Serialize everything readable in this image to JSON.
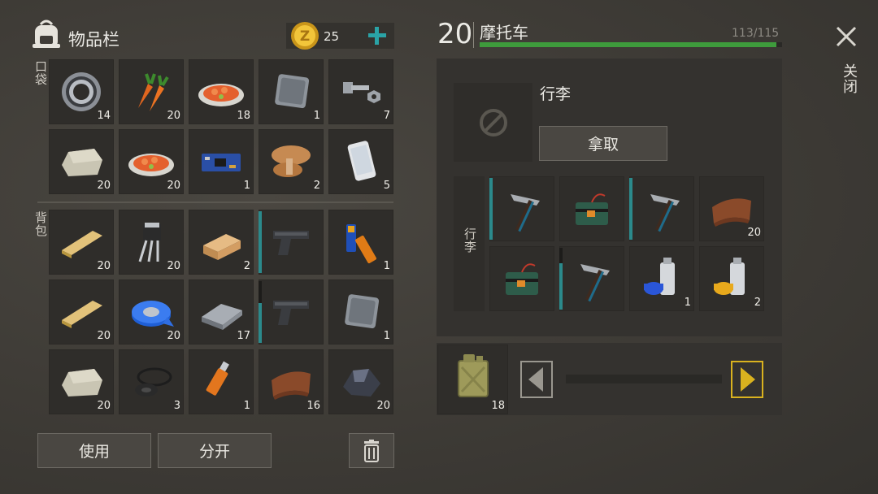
{
  "inventory": {
    "title": "物品栏",
    "coins": "25",
    "pocket_label": "口袋",
    "backpack_label": "背包",
    "pockets": [
      {
        "icon": "bearing-icon",
        "count": "14"
      },
      {
        "icon": "carrot-icon",
        "count": "20"
      },
      {
        "icon": "food-plate-icon",
        "count": "18"
      },
      {
        "icon": "metal-plate-icon",
        "count": "1"
      },
      {
        "icon": "bolt-nut-icon",
        "count": "7"
      },
      {
        "icon": "stone-icon",
        "count": "20"
      },
      {
        "icon": "food-plate-icon",
        "count": "20"
      },
      {
        "icon": "circuit-board-icon",
        "count": "1"
      },
      {
        "icon": "mushroom-icon",
        "count": "2"
      },
      {
        "icon": "smartphone-icon",
        "count": "5"
      }
    ],
    "backpack": [
      {
        "icon": "wood-plank-icon",
        "count": "20"
      },
      {
        "icon": "transistor-icon",
        "count": "20"
      },
      {
        "icon": "wood-block-icon",
        "count": "2"
      },
      {
        "icon": "pistol-icon",
        "count": "",
        "durability": 1.0
      },
      {
        "icon": "batteries-icon",
        "count": "1"
      },
      {
        "icon": "wood-plank-icon",
        "count": "20"
      },
      {
        "icon": "tape-icon",
        "count": "20"
      },
      {
        "icon": "iron-ingot-icon",
        "count": "17"
      },
      {
        "icon": "pistol-icon",
        "count": "",
        "durability": 0.65
      },
      {
        "icon": "metal-plate-icon",
        "count": "1"
      },
      {
        "icon": "stone-icon",
        "count": "20"
      },
      {
        "icon": "rubber-seals-icon",
        "count": "3"
      },
      {
        "icon": "usb-drive-icon",
        "count": "1"
      },
      {
        "icon": "leather-icon",
        "count": "16"
      },
      {
        "icon": "coal-icon",
        "count": "20"
      }
    ],
    "use_button": "使用",
    "split_button": "分开"
  },
  "vehicle": {
    "level": "20",
    "name": "摩托车",
    "capacity": "113/115",
    "capacity_fraction": 0.98,
    "luggage_title": "行李",
    "take_button": "拿取",
    "luggage_side_label": "行李",
    "items": [
      {
        "icon": "pickaxe-icon",
        "count": "",
        "durability": 1.0
      },
      {
        "icon": "explosive-charge-icon",
        "count": ""
      },
      {
        "icon": "pickaxe-icon",
        "count": "",
        "durability": 1.0
      },
      {
        "icon": "leather-icon",
        "count": "20"
      },
      {
        "icon": "explosive-charge-icon",
        "count": ""
      },
      {
        "icon": "pickaxe-icon",
        "count": "",
        "durability": 0.75
      },
      {
        "icon": "spray-paint-blue-icon",
        "count": "1"
      },
      {
        "icon": "spray-paint-yellow-icon",
        "count": "2"
      }
    ],
    "fuel_count": "18",
    "fuel_fraction": 0.0
  },
  "close_label": "关闭",
  "colors": {
    "accent": "#2aa3a6",
    "bar_green": "#3e9b3c",
    "arrow_yellow": "#d9b21f"
  }
}
